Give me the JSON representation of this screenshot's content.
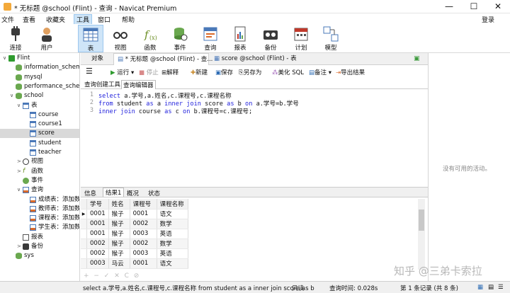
{
  "window": {
    "title": "* 无标题 @school (Flint) - 查询 - Navicat Premium",
    "minimize": "—",
    "maximize": "☐",
    "close": "✕"
  },
  "menu": [
    "文件",
    "查看",
    "收藏夹",
    "工具",
    "窗口",
    "帮助"
  ],
  "login": "登录",
  "toolbar": [
    {
      "label": "连接",
      "icon": "plug-icon"
    },
    {
      "label": "用户",
      "icon": "user-icon"
    },
    {
      "label": "表",
      "icon": "table-icon"
    },
    {
      "label": "视图",
      "icon": "glasses-icon"
    },
    {
      "label": "函数",
      "icon": "function-icon"
    },
    {
      "label": "事件",
      "icon": "event-icon"
    },
    {
      "label": "查询",
      "icon": "query-icon"
    },
    {
      "label": "报表",
      "icon": "report-icon"
    },
    {
      "label": "备份",
      "icon": "backup-icon"
    },
    {
      "label": "计划",
      "icon": "calendar-icon"
    },
    {
      "label": "模型",
      "icon": "model-icon"
    }
  ],
  "tree": [
    {
      "label": "Flint",
      "level": 0,
      "twisty": "∨",
      "icon": "connection-icon"
    },
    {
      "label": "information_schema",
      "level": 1,
      "twisty": "",
      "icon": "database-icon"
    },
    {
      "label": "mysql",
      "level": 1,
      "twisty": "",
      "icon": "database-icon"
    },
    {
      "label": "performance_schema",
      "level": 1,
      "twisty": "",
      "icon": "database-icon"
    },
    {
      "label": "school",
      "level": 1,
      "twisty": "∨",
      "icon": "database-icon"
    },
    {
      "label": "表",
      "level": 2,
      "twisty": "∨",
      "icon": "table-icon"
    },
    {
      "label": "course",
      "level": 3,
      "twisty": "",
      "icon": "table-icon"
    },
    {
      "label": "course1",
      "level": 3,
      "twisty": "",
      "icon": "table-icon"
    },
    {
      "label": "score",
      "level": 3,
      "twisty": "",
      "icon": "table-icon",
      "selected": true
    },
    {
      "label": "student",
      "level": 3,
      "twisty": "",
      "icon": "table-icon"
    },
    {
      "label": "teacher",
      "level": 3,
      "twisty": "",
      "icon": "table-icon"
    },
    {
      "label": "视图",
      "level": 2,
      "twisty": ">",
      "icon": "glasses-icon"
    },
    {
      "label": "函数",
      "level": 2,
      "twisty": ">",
      "icon": "function-icon"
    },
    {
      "label": "事件",
      "level": 2,
      "twisty": "",
      "icon": "event-icon"
    },
    {
      "label": "查询",
      "level": 2,
      "twisty": "∨",
      "icon": "query-icon"
    },
    {
      "label": "成绩表：添加数据",
      "level": 3,
      "twisty": "",
      "icon": "query-icon"
    },
    {
      "label": "教师表：添加数据",
      "level": 3,
      "twisty": "",
      "icon": "query-icon"
    },
    {
      "label": "课程表：添加数据",
      "level": 3,
      "twisty": "",
      "icon": "query-icon"
    },
    {
      "label": "学生表：添加数据",
      "level": 3,
      "twisty": "",
      "icon": "query-icon"
    },
    {
      "label": "报表",
      "level": 2,
      "twisty": "",
      "icon": "report-icon"
    },
    {
      "label": "备份",
      "level": 2,
      "twisty": ">",
      "icon": "backup-icon"
    },
    {
      "label": "sys",
      "level": 1,
      "twisty": "",
      "icon": "database-icon"
    }
  ],
  "tabs": {
    "objects": "对象",
    "query": "* 无标题 @school (Flint) - 查...",
    "score": "score @school (Flint) - 表"
  },
  "query_toolbar": {
    "run": "运行",
    "stop": "停止",
    "explain": "解释",
    "new": "新建",
    "save": "保存",
    "save_as": "另存为",
    "beautify": "美化 SQL",
    "note": "备注",
    "export": "导出结果"
  },
  "subtabs": [
    "查询创建工具",
    "查询编辑器"
  ],
  "editor": {
    "lines": [
      "1",
      "2",
      "3"
    ],
    "code": [
      [
        {
          "t": "select",
          "k": true
        },
        {
          "t": " a.学号,a.姓名,c.课程号,c.课程名称"
        }
      ],
      [
        {
          "t": "from",
          "k": true
        },
        {
          "t": " student "
        },
        {
          "t": "as",
          "k": true
        },
        {
          "t": " a "
        },
        {
          "t": "inner join",
          "k": true
        },
        {
          "t": " score "
        },
        {
          "t": "as",
          "k": true
        },
        {
          "t": " b "
        },
        {
          "t": "on",
          "k": true
        },
        {
          "t": " a.学号=b.学号"
        }
      ],
      [
        {
          "t": "inner join",
          "k": true
        },
        {
          "t": " course "
        },
        {
          "t": "as",
          "k": true
        },
        {
          "t": " c "
        },
        {
          "t": "on",
          "k": true
        },
        {
          "t": " b.课程号=c.课程号;"
        }
      ]
    ]
  },
  "result_tabs": [
    "信息",
    "结果1",
    "概况",
    "状态"
  ],
  "results": {
    "columns": [
      "学号",
      "姓名",
      "课程号",
      "课程名称"
    ],
    "rows": [
      [
        "0001",
        "猴子",
        "0001",
        "语文"
      ],
      [
        "0001",
        "猴子",
        "0002",
        "数学"
      ],
      [
        "0001",
        "猴子",
        "0003",
        "英语"
      ],
      [
        "0002",
        "猴子",
        "0002",
        "数学"
      ],
      [
        "0002",
        "猴子",
        "0003",
        "英语"
      ],
      [
        "0003",
        "马云",
        "0001",
        "语文"
      ]
    ]
  },
  "grid_footer": "+ − ✓ ✕ C ⊘",
  "right_pane": {
    "empty": "没有可用的活动。"
  },
  "status": {
    "sql": "select a.学号,a.姓名,c.课程号,c.课程名称 from student as a inner join score as b",
    "readonly": "只读",
    "time": "查询时间: 0.028s",
    "records": "第 1 条记录 (共 8 条)"
  },
  "watermark": "知乎 @三弟卡索拉"
}
